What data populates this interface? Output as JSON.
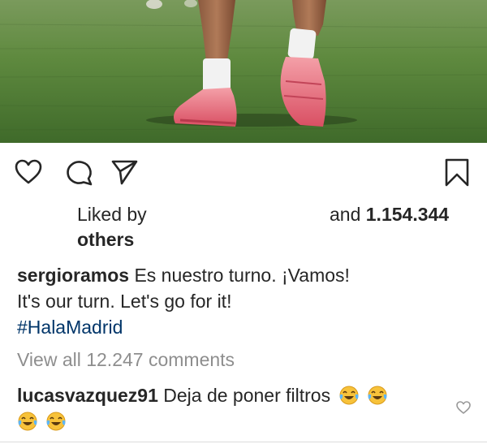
{
  "post": {
    "image_alt": "Football player legs in pink boots on grass",
    "colors": {
      "boot_pink": "#e8677a",
      "grass_green": "#5f8a3f",
      "hashtag_blue": "#003569",
      "muted_gray": "#8e8e8e"
    }
  },
  "actions": {
    "like_icon": "heart-icon",
    "comment_icon": "comment-icon",
    "share_icon": "paper-plane-icon",
    "save_icon": "bookmark-icon"
  },
  "likes": {
    "liked_by": "Liked by",
    "and_prefix": "and ",
    "count": "1.154.344",
    "others": "others"
  },
  "caption": {
    "username": "sergioramos",
    "line1": " Es nuestro turno. ¡Vamos!",
    "line2": "It's our turn. Let's go for it!",
    "hashtag": "#HalaMadrid"
  },
  "comments": {
    "view_all": "View all 12.247 comments",
    "items": [
      {
        "username": "lucasvazquez91",
        "text": " Deja de poner filtros",
        "emoji": "face-with-tears-of-joy"
      }
    ]
  }
}
